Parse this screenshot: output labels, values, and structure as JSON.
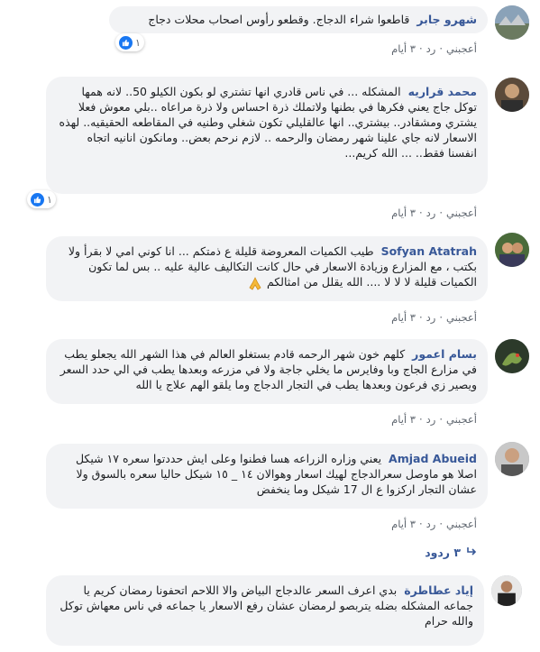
{
  "comments": [
    {
      "author": "شهرو جابر",
      "text": "قاطعوا شراء الدجاج. وقطعو رأوس اصحاب محلات دجاج",
      "like": "أعجبني",
      "reply": "رد",
      "time": "٣ أيام",
      "reactions": "١"
    },
    {
      "author": "محمد قراريه",
      "text": "المشكله ... في ناس قادري انها تشتري لو بكون الكيلو 50.. لانه همها توكل جاج يعني فكرها في بطنها ولاتملك ذرة احساس ولا ذرة مراعاه ..بلي معوش فعلا يشتري ومشقادر.. بيشتري.. انها عالقليلي تكون شغلي وطنيه في المقاطعه الحقيقيه.. لهذه الاسعار لانه جاي علينا شهر رمضان والرحمه .. لازم نرحم بعض.. ومانكون انانيه اتجاه انفسنا فقط.. ... الله كريم...",
      "like": "أعجبني",
      "reply": "رد",
      "time": "٣ أيام",
      "reactions": "١"
    },
    {
      "author": "Sofyan Atatrah",
      "text": "طيب الكميات المعروضة قليلة ع ذمتكم ... انا كوني امي لا بقرأ ولا بكتب ، مع المزارع وزيادة الاسعار في حال كانت التكاليف عالية عليه .. بس لما تكون الكميات قليلة لا لا لا .... الله يقلل من امثالكم",
      "like": "أعجبني",
      "reply": "رد",
      "time": "٣ أيام"
    },
    {
      "author": "بسام اعمور",
      "text": "كلهم خون شهر الرحمه قادم بستغلو العالم في هذا الشهر الله يجعلو يطب في مزارع الجاج وبا وفايرس ما يخلي جاجة ولا في مزرعه وبعدها يطب في الي حدد السعر ويصير زي فرعون وبعدها يطب في التجار الدجاج وما يلقو الهم علاج يا الله",
      "like": "أعجبني",
      "reply": "رد",
      "time": "٣ أيام"
    },
    {
      "author": "Amjad Abueid",
      "text": "يعني وزاره الزراعه هسا فطنوا وعلى ايش حددتوا سعره ١٧ شيكل اصلا هو ماوصل سعرالدجاج لهيك اسعار وهوالان ١٤ _ ١٥ شيكل حاليا سعره بالسوق ولا عشان التجار اركزوا ع ال 17 شيكل وما ينخفض",
      "like": "أعجبني",
      "reply": "رد",
      "time": "٣ أيام"
    },
    {
      "author": "إياد عطاطرة",
      "text": "بدي اعرف السعر عالدجاج البياض والا اللاحم اتحفونا رمضان كريم يا جماعه المشكله بضله يتربصو لرمضان عشان رفع الاسعار يا جماعه في ناس معهاش توكل والله حرام"
    }
  ],
  "replies_label": "٣ ردود",
  "colors": {
    "link": "#385898",
    "bubble": "#f2f3f5",
    "like": "#1877f2"
  }
}
